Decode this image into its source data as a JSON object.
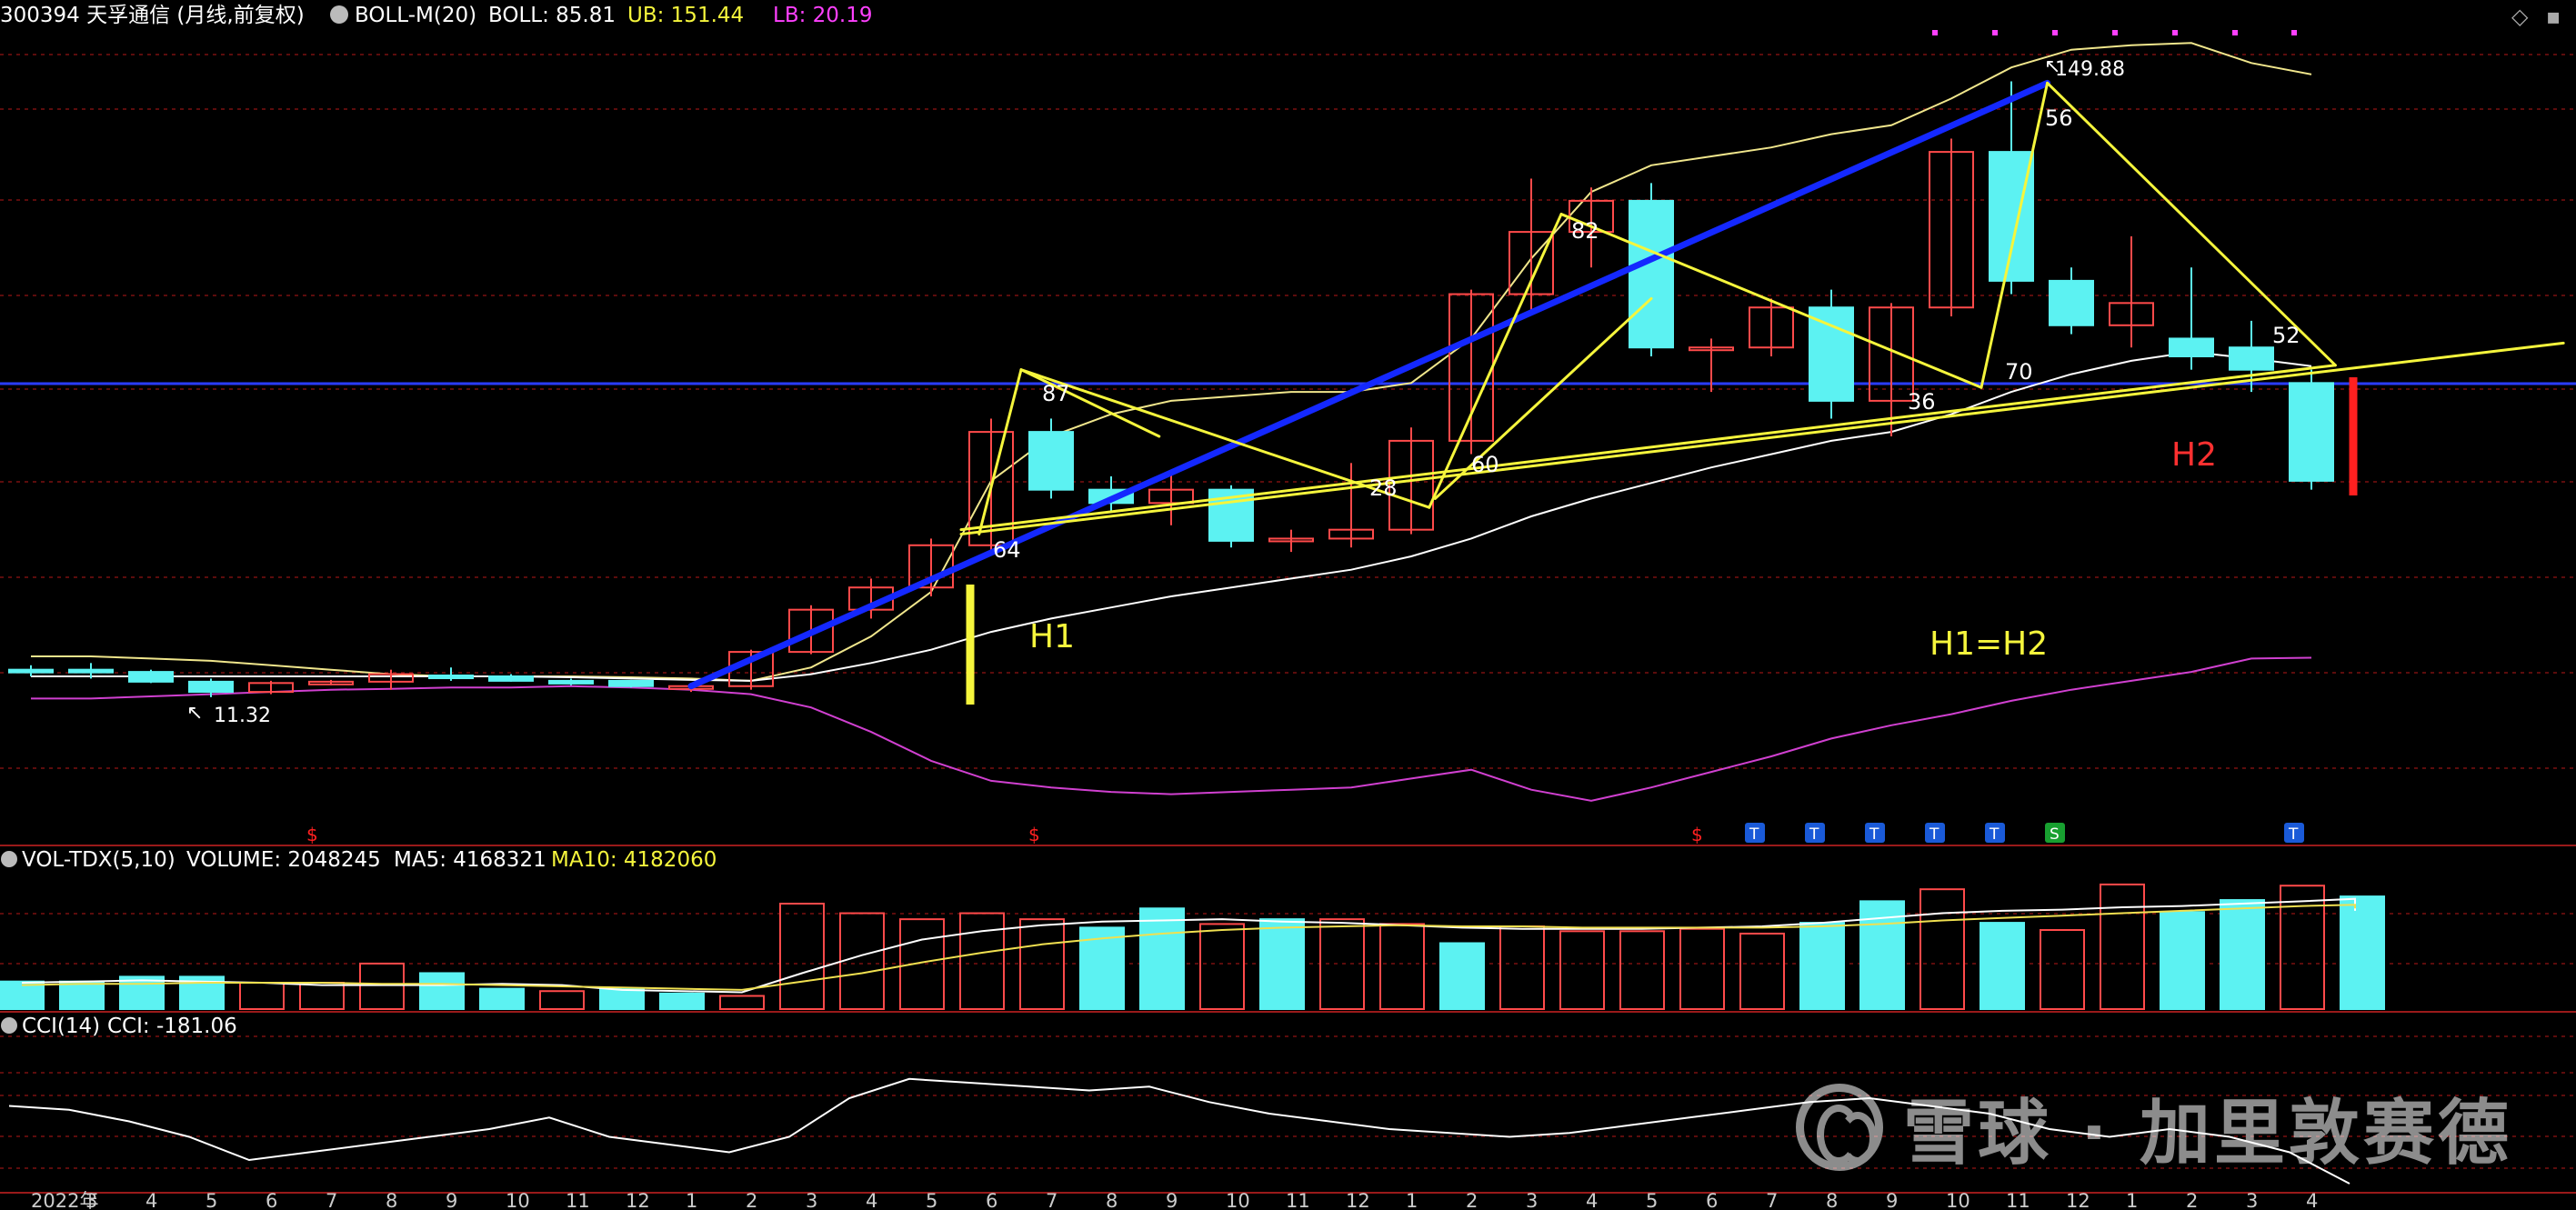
{
  "colors": {
    "background": "#000000",
    "up_candle": "#ff4a4a",
    "down_candle": "#5cf2f2",
    "grid": "#7a1010",
    "panel_border": "#9a1a1a",
    "boll_mid": "#ffffff",
    "boll_upper": "#f0e68c",
    "boll_lower": "#d040d0",
    "vol_ma5": "#ffffff",
    "vol_ma10": "#f0e050",
    "cci": "#ffffff",
    "drawing_yellow": "#f5f53c",
    "drawing_blue": "#1428ff",
    "horizontal_line": "#2a3cff",
    "signal_red": "#ff2020",
    "text_white": "#ffffff",
    "text_yellow": "#f5f53c",
    "text_magenta": "#ff40ff",
    "ann_text": "#ffffff",
    "red_label": "#ff3030"
  },
  "main_header": {
    "code_name": "300394 天孚通信 (月线,前复权)",
    "indicator": "BOLL-M(20)",
    "boll": "BOLL: 85.81",
    "ub": "UB: 151.44",
    "lb": "LB: 20.19"
  },
  "volume_header": {
    "indicator": "VOL-TDX(5,10)",
    "volume": "VOLUME: 2048245",
    "ma5": "MA5: 4168321",
    "ma10": "MA10: 4182060"
  },
  "cci_header": {
    "indicator": "CCI(14)",
    "cci": "CCI: -181.06"
  },
  "price_labels": {
    "high": "149.88",
    "low": "11.32"
  },
  "annotations": {
    "h1": "H1",
    "h2": "H2",
    "h1_eq_h2": "H1=H2",
    "angles": [
      "87",
      "64",
      "28",
      "60",
      "82",
      "36",
      "70",
      "56",
      "52"
    ]
  },
  "watermark": {
    "logo": "雪球",
    "text": "雪球 · 加里敦赛德"
  },
  "chart_data": [
    {
      "type": "candlestick",
      "title": "300394 天孚通信 (月线,前复权)",
      "period": "monthly",
      "x_labels": [
        "2022年",
        "3",
        "4",
        "5",
        "6",
        "7",
        "8",
        "9",
        "10",
        "11",
        "12",
        "1",
        "2",
        "3",
        "4",
        "5",
        "6",
        "7",
        "8",
        "9",
        "10",
        "11",
        "12",
        "1",
        "2",
        "3",
        "4",
        "5",
        "6",
        "7",
        "8",
        "9",
        "10",
        "11",
        "12",
        "1",
        "2",
        "3",
        "4"
      ],
      "candles": [
        {
          "o": 17.5,
          "h": 18.5,
          "l": 16.0,
          "c": 17.0
        },
        {
          "o": 17.5,
          "h": 19.0,
          "l": 15.5,
          "c": 17.0
        },
        {
          "o": 17.0,
          "h": 17.5,
          "l": 14.5,
          "c": 14.8
        },
        {
          "o": 14.8,
          "h": 15.5,
          "l": 11.32,
          "c": 12.5
        },
        {
          "o": 12.5,
          "h": 15.0,
          "l": 12.0,
          "c": 14.5
        },
        {
          "o": 14.5,
          "h": 15.2,
          "l": 14.0,
          "c": 14.8
        },
        {
          "o": 14.8,
          "h": 17.5,
          "l": 13.0,
          "c": 16.5
        },
        {
          "o": 16.2,
          "h": 18.0,
          "l": 15.0,
          "c": 16.0
        },
        {
          "o": 16.0,
          "h": 16.5,
          "l": 14.8,
          "c": 15.0
        },
        {
          "o": 15.0,
          "h": 15.5,
          "l": 14.0,
          "c": 14.7
        },
        {
          "o": 15.0,
          "h": 15.2,
          "l": 13.5,
          "c": 13.8
        },
        {
          "o": 13.5,
          "h": 14.5,
          "l": 12.5,
          "c": 13.8
        },
        {
          "o": 13.8,
          "h": 22.0,
          "l": 13.0,
          "c": 21.5
        },
        {
          "o": 21.5,
          "h": 32.0,
          "l": 21.0,
          "c": 31.0
        },
        {
          "o": 31.0,
          "h": 38.0,
          "l": 29.0,
          "c": 36.0
        },
        {
          "o": 36.0,
          "h": 47.0,
          "l": 34.0,
          "c": 45.5
        },
        {
          "o": 45.5,
          "h": 74.0,
          "l": 44.0,
          "c": 71.0
        },
        {
          "o": 71.0,
          "h": 74.0,
          "l": 56.0,
          "c": 58.0
        },
        {
          "o": 58.0,
          "h": 61.0,
          "l": 53.0,
          "c": 55.0
        },
        {
          "o": 55.0,
          "h": 62.0,
          "l": 50.0,
          "c": 58.0
        },
        {
          "o": 58.0,
          "h": 59.0,
          "l": 45.0,
          "c": 46.5
        },
        {
          "o": 46.5,
          "h": 49.0,
          "l": 44.0,
          "c": 47.0
        },
        {
          "o": 47.0,
          "h": 64.0,
          "l": 45.0,
          "c": 49.0
        },
        {
          "o": 49.0,
          "h": 72.0,
          "l": 48.0,
          "c": 69.0
        },
        {
          "o": 69.0,
          "h": 103.0,
          "l": 66.0,
          "c": 102.0
        },
        {
          "o": 102.0,
          "h": 128.0,
          "l": 98.0,
          "c": 116.0
        },
        {
          "o": 116.0,
          "h": 126.0,
          "l": 108.0,
          "c": 123.0
        },
        {
          "o": 123.0,
          "h": 127.0,
          "l": 88.0,
          "c": 90.0
        },
        {
          "o": 90.0,
          "h": 92.0,
          "l": 80.0,
          "c": 90.0
        },
        {
          "o": 90.0,
          "h": 101.0,
          "l": 88.0,
          "c": 99.0
        },
        {
          "o": 99.0,
          "h": 103.0,
          "l": 74.0,
          "c": 78.0
        },
        {
          "o": 78.0,
          "h": 100.0,
          "l": 70.0,
          "c": 99.0
        },
        {
          "o": 99.0,
          "h": 137.0,
          "l": 97.0,
          "c": 134.0
        },
        {
          "o": 134.0,
          "h": 149.88,
          "l": 102.0,
          "c": 105.0
        },
        {
          "o": 105.0,
          "h": 108.0,
          "l": 93.0,
          "c": 95.0
        },
        {
          "o": 95.0,
          "h": 115.0,
          "l": 90.0,
          "c": 100.0
        },
        {
          "o": 92.0,
          "h": 108.0,
          "l": 85.0,
          "c": 88.0
        },
        {
          "o": 90.0,
          "h": 96.0,
          "l": 80.0,
          "c": 85.0
        },
        {
          "o": 82.0,
          "h": 85.0,
          "l": 58.0,
          "c": 60.0
        }
      ],
      "boll_upper": [
        20.5,
        20.5,
        20.0,
        19.5,
        18.5,
        17.5,
        16.5,
        16.0,
        16.0,
        16.0,
        15.8,
        15.5,
        15.0,
        18.0,
        25.0,
        35.0,
        60.0,
        70.0,
        75.0,
        78.0,
        79.0,
        80.0,
        80.0,
        82.0,
        92.0,
        110.0,
        125.0,
        131.0,
        133.0,
        135.0,
        138.0,
        140.0,
        146.0,
        153.0,
        157.0,
        158.0,
        158.5,
        154.0,
        151.44
      ],
      "boll_mid": [
        16.0,
        16.0,
        16.0,
        16.0,
        16.0,
        16.0,
        16.0,
        16.0,
        16.0,
        15.8,
        15.5,
        15.2,
        15.0,
        16.5,
        19.0,
        22.0,
        26.0,
        29.0,
        31.5,
        34.0,
        36.0,
        38.0,
        40.0,
        43.0,
        47.0,
        52.0,
        56.0,
        59.5,
        63.0,
        66.0,
        69.0,
        71.0,
        75.0,
        80.0,
        84.0,
        87.0,
        89.0,
        87.5,
        85.81
      ],
      "boll_lower": [
        11.0,
        11.0,
        11.5,
        12.0,
        12.5,
        13.0,
        13.2,
        13.5,
        13.5,
        13.8,
        13.5,
        13.0,
        12.0,
        9.0,
        3.5,
        -3.0,
        -7.5,
        -9.0,
        -10.0,
        -10.5,
        -10.0,
        -9.5,
        -9.0,
        -7.0,
        -5.0,
        -9.5,
        -12.0,
        -9.0,
        -5.5,
        -2.0,
        2.0,
        5.0,
        7.5,
        10.5,
        13.0,
        15.0,
        17.0,
        20.0,
        20.19
      ]
    },
    {
      "type": "bar",
      "title": "VOL-TDX(5,10)",
      "values": [
        2.3,
        2.3,
        2.7,
        2.7,
        2.2,
        2.2,
        3.8,
        3.0,
        1.7,
        1.5,
        1.7,
        1.3,
        1.1,
        8.8,
        8.0,
        7.5,
        8.0,
        7.5,
        6.8,
        8.4,
        7.1,
        7.5,
        7.5,
        7.1,
        5.5,
        6.9,
        6.5,
        6.5,
        6.7,
        6.3,
        7.2,
        9.0,
        10.0,
        7.2,
        6.6,
        10.4,
        8.1,
        9.1,
        10.3,
        9.4,
        8.2,
        4.2
      ],
      "directions": [
        "down",
        "down",
        "down",
        "down",
        "up",
        "up",
        "up",
        "down",
        "down",
        "up",
        "down",
        "down",
        "up",
        "up",
        "up",
        "up",
        "up",
        "up",
        "down",
        "down",
        "up",
        "down",
        "up",
        "up",
        "down",
        "up",
        "up",
        "up",
        "up",
        "up",
        "down",
        "down",
        "up",
        "down",
        "up",
        "up",
        "down",
        "down",
        "up",
        "down",
        "down",
        "down"
      ],
      "ma5": [
        2.2,
        2.3,
        2.4,
        2.3,
        2.2,
        2.0,
        2.0,
        2.0,
        2.1,
        2.0,
        1.6,
        1.5,
        1.4,
        3.0,
        4.5,
        5.8,
        6.5,
        7.0,
        7.3,
        7.4,
        7.5,
        7.3,
        7.2,
        7.0,
        6.8,
        6.7,
        6.7,
        6.7,
        6.8,
        6.9,
        7.2,
        7.6,
        8.0,
        8.2,
        8.3,
        8.5,
        8.6,
        8.8,
        9.0,
        9.2,
        8.8,
        8.2
      ],
      "ma10": [
        2.0,
        2.1,
        2.1,
        2.2,
        2.2,
        2.2,
        2.1,
        2.1,
        2.0,
        1.9,
        1.8,
        1.7,
        1.6,
        2.3,
        3.0,
        3.9,
        4.7,
        5.4,
        5.9,
        6.3,
        6.6,
        6.8,
        6.9,
        7.0,
        6.9,
        6.9,
        6.8,
        6.8,
        6.8,
        6.8,
        6.9,
        7.1,
        7.4,
        7.6,
        7.8,
        8.0,
        8.2,
        8.4,
        8.6,
        8.7,
        8.6,
        8.4
      ],
      "ylim": [
        0,
        11
      ]
    },
    {
      "type": "line",
      "title": "CCI(14)",
      "values": [
        20,
        10,
        -20,
        -60,
        -120,
        -100,
        -80,
        -60,
        -40,
        -10,
        -60,
        -80,
        -100,
        -60,
        40,
        90,
        80,
        70,
        60,
        70,
        30,
        0,
        -20,
        -40,
        -50,
        -60,
        -50,
        -30,
        -10,
        10,
        30,
        40,
        20,
        0,
        -40,
        -60,
        -40,
        -60,
        -100,
        -181.06
      ],
      "ylim": [
        -200,
        200
      ]
    }
  ]
}
